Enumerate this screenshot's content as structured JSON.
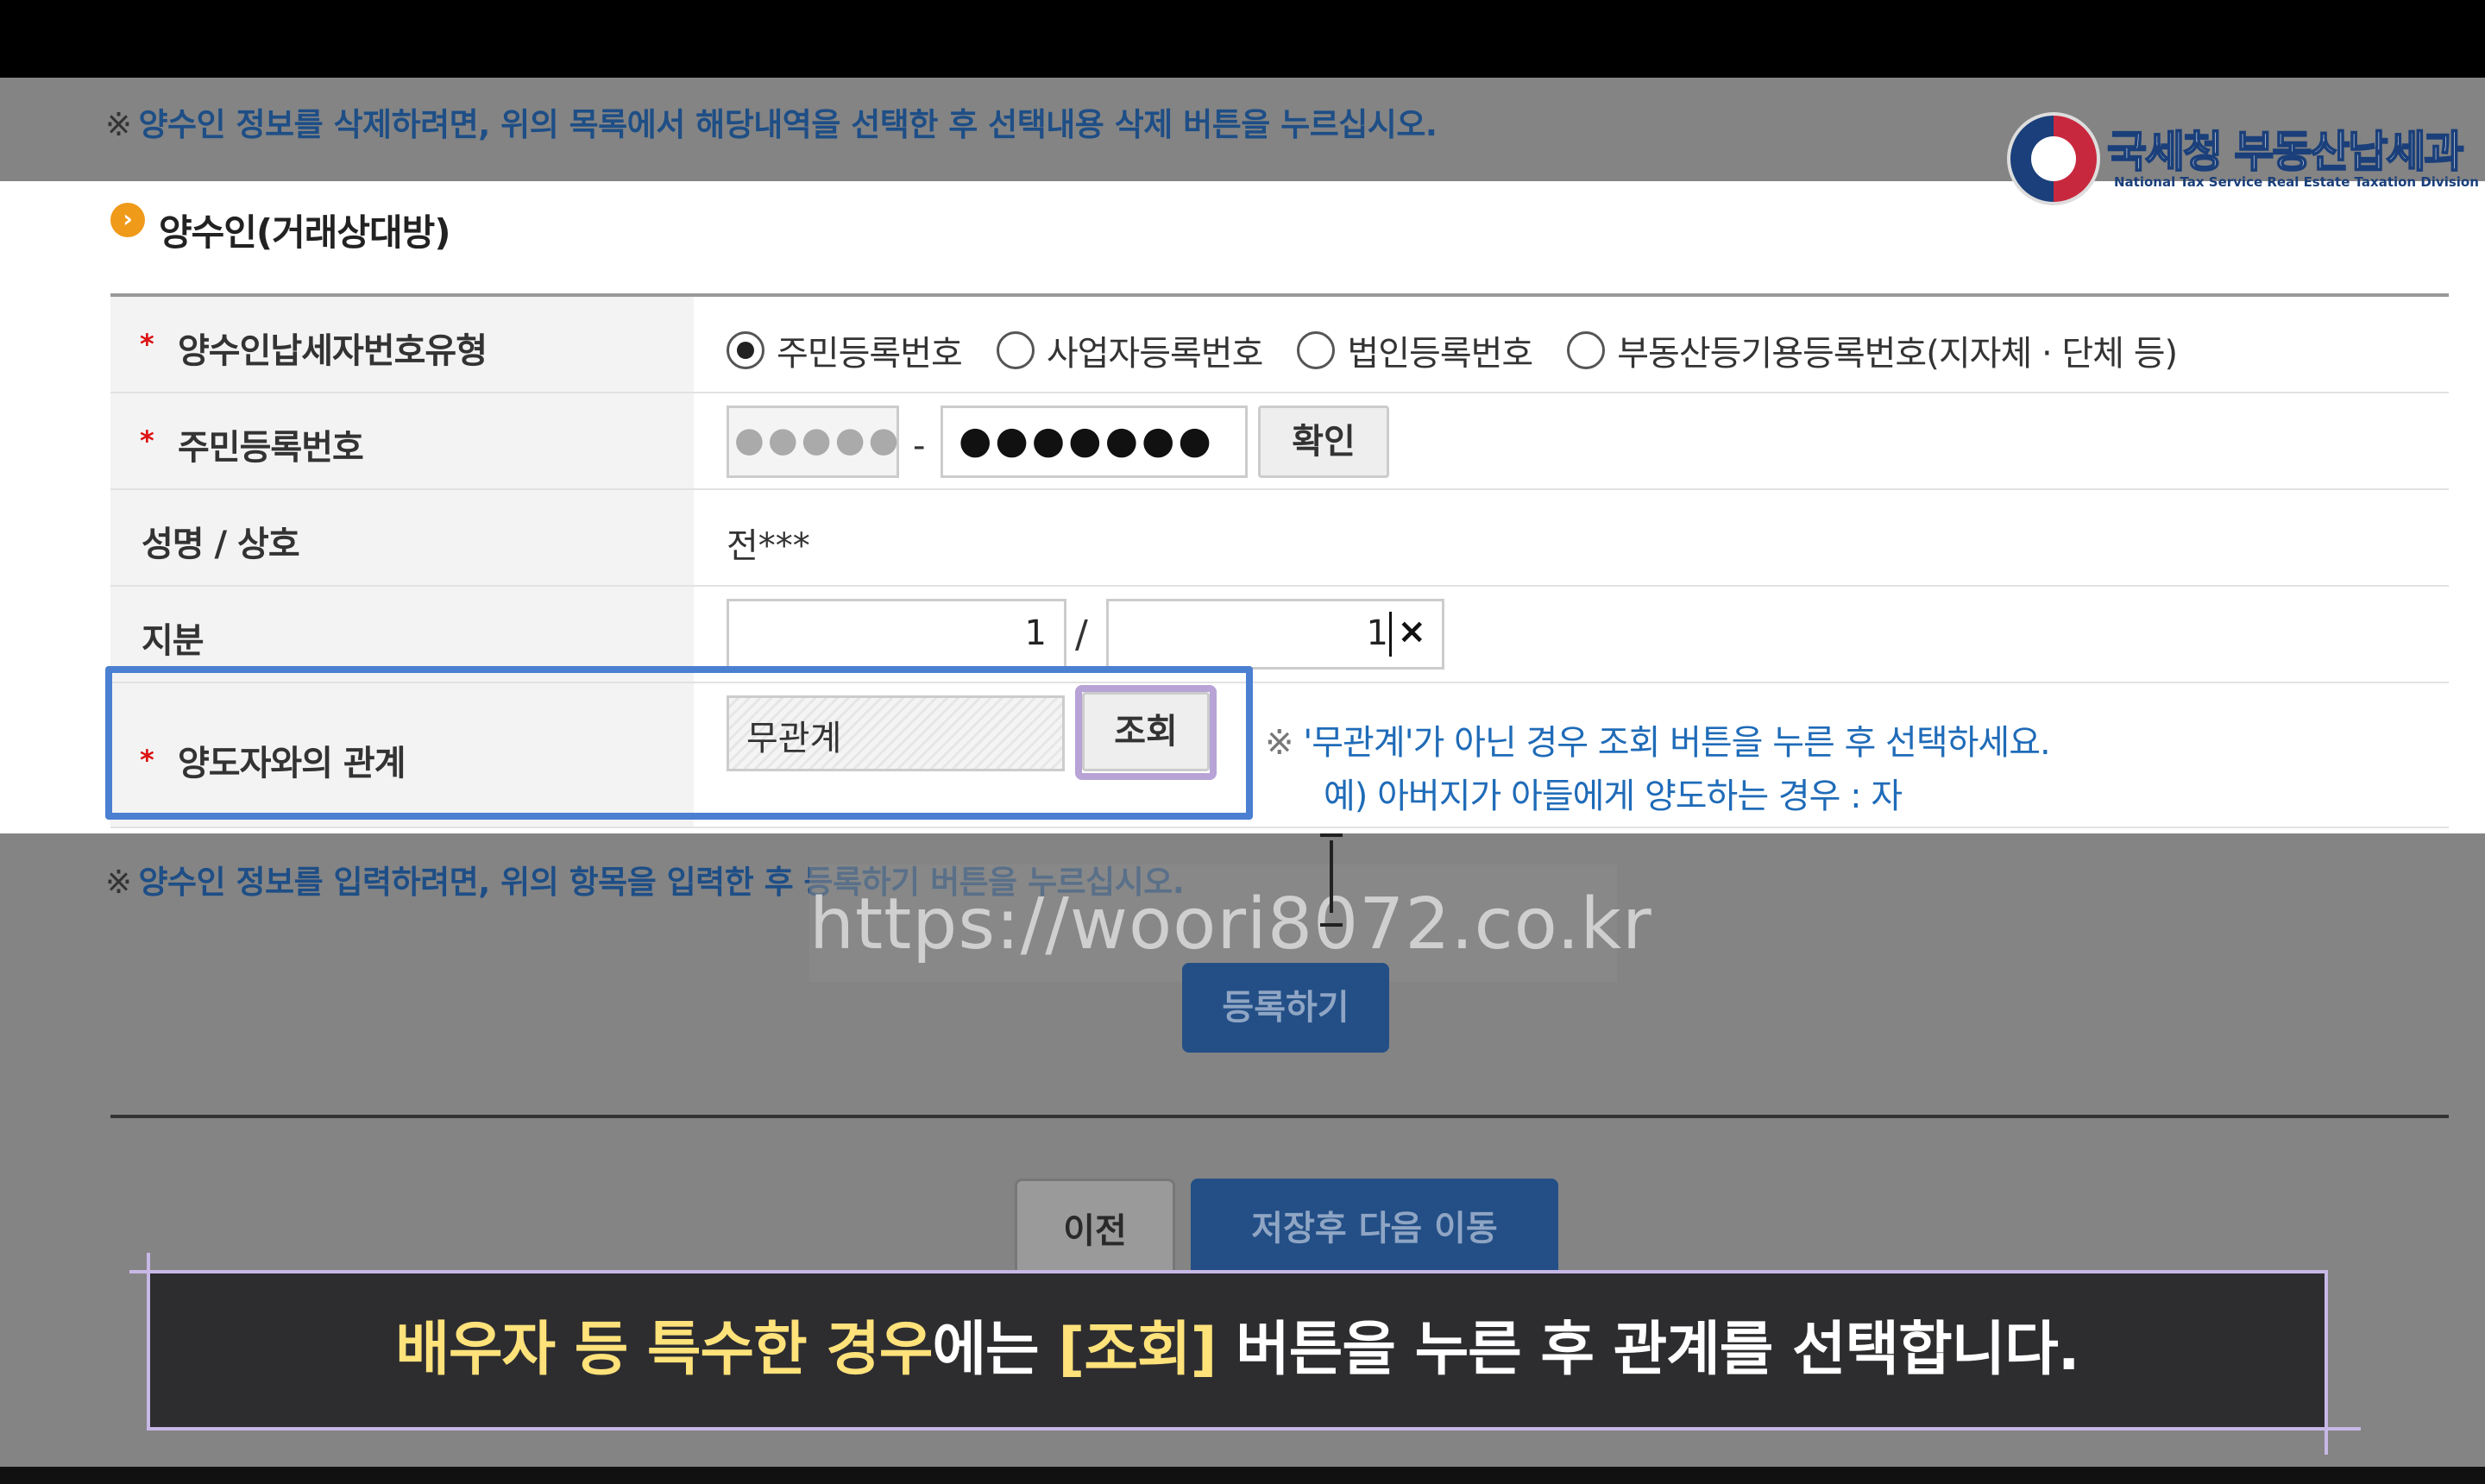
{
  "notices": {
    "mark": "※",
    "top": "양수인 정보를 삭제하려면, 위의 목록에서 해당내역을 선택한 후 선택내용 삭제 버튼을 누르십시오.",
    "bottom": "양수인 정보를 입력하려면, 위의 항목을 입력한 후 등록하기 버튼을 누르십시오."
  },
  "logo": {
    "title": "국세청 부동산납세과",
    "subtitle": "National Tax Service Real Estate Taxation Division"
  },
  "section": {
    "bullet": "›",
    "title": "양수인(거래상대방)"
  },
  "form": {
    "required_mark": "*",
    "taxpayer_type": {
      "label": "양수인납세자번호유형",
      "options": [
        "주민등록번호",
        "사업자등록번호",
        "법인등록번호",
        "부동산등기용등록번호(지자체 · 단체 등)"
      ],
      "selected": "주민등록번호"
    },
    "resident_number": {
      "label": "주민등록번호",
      "first_part": "●●●●●",
      "separator": "-",
      "second_part": "●●●●●●●",
      "confirm_label": "확인"
    },
    "name": {
      "label": "성명 / 상호",
      "value": "전***"
    },
    "share": {
      "label": "지분",
      "numerator": "1",
      "slash": "/",
      "denominator": "1",
      "clear_label": "×"
    },
    "relationship": {
      "label": "양도자와의 관계",
      "value": "무관계",
      "lookup_label": "조회",
      "hint_mark": "※",
      "hint_line1": "'무관계'가 아닌 경우 조회 버튼을 누른 후 선택하세요.",
      "hint_line2": "예) 아버지가 아들에게 양도하는 경우 : 자"
    }
  },
  "watermark": "https://woori8072.co.kr",
  "buttons": {
    "register": "등록하기",
    "prev": "이전",
    "save_next": "저장후 다음 이동"
  },
  "subtitle": {
    "highlight1": "배우자 등 특수한 경우",
    "text1": "에는 ",
    "highlight2": "[조회]",
    "text2": " 버튼을 누른 후 관계를 선택합니다."
  },
  "colors": {
    "highlight_blue": "#4a7fd1",
    "highlight_purple": "#b7a3d6",
    "subtitle_yellow": "#ffe27a",
    "notice_blue": "#1e4e86"
  }
}
